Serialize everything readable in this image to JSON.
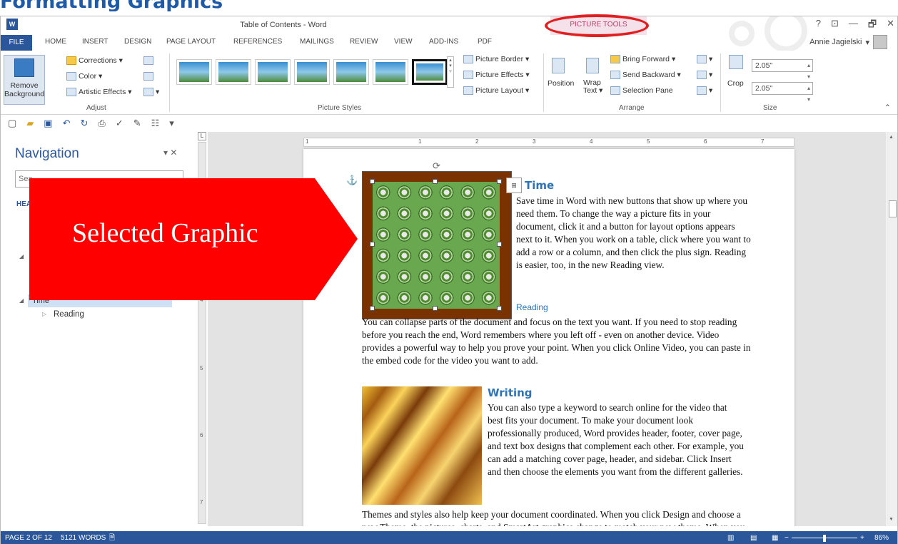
{
  "slide_title": "Formatting Graphics",
  "window": {
    "doc_title": "Table of Contents - Word",
    "contextual_tab": "PICTURE TOOLS",
    "controls": [
      "?",
      "⊡",
      "—",
      "🗗",
      "✕"
    ]
  },
  "tabs": {
    "file": "FILE",
    "items": [
      "HOME",
      "INSERT",
      "DESIGN",
      "PAGE LAYOUT",
      "REFERENCES",
      "MAILINGS",
      "REVIEW",
      "VIEW",
      "ADD-INS",
      "PDF"
    ],
    "user": "Annie Jagielski"
  },
  "ribbon": {
    "adjust": {
      "remove_bg": "Remove Background",
      "corrections": "Corrections ▾",
      "color": "Color ▾",
      "artistic": "Artistic Effects ▾",
      "label": "Adjust"
    },
    "styles": {
      "border": "Picture Border ▾",
      "effects": "Picture Effects ▾",
      "layout": "Picture Layout ▾",
      "label": "Picture Styles"
    },
    "arrange": {
      "position": "Position",
      "wrap": "Wrap Text ▾",
      "bring_forward": "Bring Forward",
      "send_backward": "Send Backward",
      "selection_pane": "Selection Pane",
      "label": "Arrange"
    },
    "size": {
      "crop": "Crop",
      "height": "2.05\"",
      "width": "2.05\"",
      "label": "Size"
    }
  },
  "navigation": {
    "title": "Navigation",
    "search_placeholder": "Sea",
    "headings_tab": "HEA",
    "selected_item": "Time",
    "child_item": "Reading"
  },
  "document": {
    "heading_time": "Time",
    "time_para": "Save time in Word with new buttons that show up where you need them. To change the way a picture fits in your document, click it and a button for layout options appears next to it. When you work on a table, click where you want to add a row or a column, and then click the plus sign. Reading is easier, too, in the new Reading view.",
    "reading_label": "Reading",
    "reading_para": "You can collapse parts of the document and focus on the text you want. If you need to stop reading before you reach the end, Word remembers where you left off - even on another device. Video provides a powerful way to help you prove your point. When you click Online Video, you can paste in the embed code for the video you want to add.",
    "heading_writing": "Writing",
    "writing_para": "You can also type a keyword to search online for the video that best fits your document. To make your document look professionally produced, Word provides header, footer, cover page, and text box designs that complement each other. For example, you can add a matching cover page, header, and sidebar. Click Insert and then choose the elements you want from the different galleries.",
    "themes_para": "Themes and styles also help keep your document coordinated. When you click Design and choose a new Theme, the pictures, charts, and SmartArt graphics change to match your new theme. When you apply styles, your headings change to"
  },
  "callout": {
    "text": "Selected Graphic",
    "color": "#ff0000"
  },
  "ruler": {
    "h_numbers": [
      "1",
      "1",
      "2",
      "3",
      "4",
      "5",
      "6",
      "7"
    ],
    "v_numbers": [
      "4",
      "5",
      "6",
      "7"
    ]
  },
  "status": {
    "page": "PAGE 2 OF 12",
    "words": "5121 WORDS",
    "zoom": "86%"
  },
  "colors": {
    "accent": "#2b579a",
    "picture_tools": "#c23b66",
    "highlight_ring": "#e02020"
  }
}
